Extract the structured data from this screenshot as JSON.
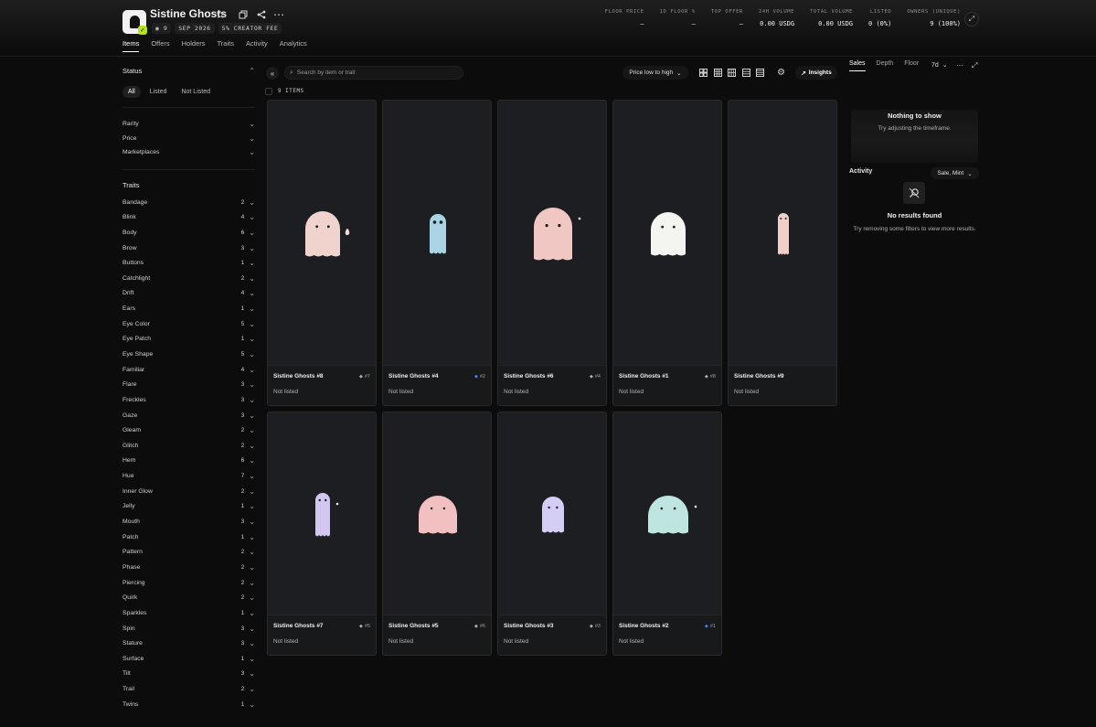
{
  "collection": {
    "title": "Sistine Ghosts",
    "items_badge": "9",
    "created": "SEP 2026",
    "creator_fee": "5% CREATOR FEE"
  },
  "header_icons": [
    "star-icon",
    "copy-icon",
    "share-icon",
    "more-icon"
  ],
  "tabs": [
    {
      "label": "Items",
      "active": true
    },
    {
      "label": "Offers",
      "active": false
    },
    {
      "label": "Holders",
      "active": false
    },
    {
      "label": "Traits",
      "active": false
    },
    {
      "label": "Activity",
      "active": false
    },
    {
      "label": "Analytics",
      "active": false
    }
  ],
  "stats": [
    {
      "label": "FLOOR PRICE",
      "value": "—"
    },
    {
      "label": "1D FLOOR %",
      "value": "—"
    },
    {
      "label": "TOP OFFER",
      "value": "—"
    },
    {
      "label": "24H VOLUME",
      "value": "0.00 USDG"
    },
    {
      "label": "TOTAL VOLUME",
      "value": "0.00 USDG"
    },
    {
      "label": "LISTED",
      "value": "0 (0%)"
    },
    {
      "label": "OWNERS (UNIQUE)",
      "value": "9 (100%)"
    }
  ],
  "sidebar": {
    "status_title": "Status",
    "status_filters": [
      {
        "label": "All",
        "active": true
      },
      {
        "label": "Listed",
        "active": false
      },
      {
        "label": "Not Listed",
        "active": false
      }
    ],
    "filters": [
      "Rarity",
      "Price",
      "Marketplaces"
    ],
    "traits_title": "Traits",
    "traits": [
      {
        "name": "Bandage",
        "count": "2"
      },
      {
        "name": "Blink",
        "count": "4"
      },
      {
        "name": "Body",
        "count": "6"
      },
      {
        "name": "Brow",
        "count": "3"
      },
      {
        "name": "Buttons",
        "count": "1"
      },
      {
        "name": "Catchlight",
        "count": "2"
      },
      {
        "name": "Drift",
        "count": "4"
      },
      {
        "name": "Ears",
        "count": "1"
      },
      {
        "name": "Eye Color",
        "count": "5"
      },
      {
        "name": "Eye Patch",
        "count": "1"
      },
      {
        "name": "Eye Shape",
        "count": "5"
      },
      {
        "name": "Familiar",
        "count": "4"
      },
      {
        "name": "Flare",
        "count": "3"
      },
      {
        "name": "Freckles",
        "count": "3"
      },
      {
        "name": "Gaze",
        "count": "3"
      },
      {
        "name": "Gleam",
        "count": "2"
      },
      {
        "name": "Glitch",
        "count": "2"
      },
      {
        "name": "Hem",
        "count": "6"
      },
      {
        "name": "Hue",
        "count": "7"
      },
      {
        "name": "Inner Glow",
        "count": "2"
      },
      {
        "name": "Jelly",
        "count": "1"
      },
      {
        "name": "Mouth",
        "count": "3"
      },
      {
        "name": "Patch",
        "count": "1"
      },
      {
        "name": "Pattern",
        "count": "2"
      },
      {
        "name": "Phase",
        "count": "2"
      },
      {
        "name": "Piercing",
        "count": "2"
      },
      {
        "name": "Quirk",
        "count": "2"
      },
      {
        "name": "Sparkles",
        "count": "1"
      },
      {
        "name": "Spin",
        "count": "3"
      },
      {
        "name": "Stature",
        "count": "3"
      },
      {
        "name": "Surface",
        "count": "1"
      },
      {
        "name": "Tilt",
        "count": "3"
      },
      {
        "name": "Trail",
        "count": "2"
      },
      {
        "name": "Twins",
        "count": "1"
      }
    ]
  },
  "toolbar": {
    "search_placeholder": "Search by item or trait",
    "sort_label": "Price low to high",
    "insights_label": "Insights",
    "items_count": "9 ITEMS"
  },
  "items": [
    {
      "name": "Sistine Ghosts #8",
      "rank": "#7",
      "rank_color": "gray",
      "price": "Not listed",
      "ghost": "pink"
    },
    {
      "name": "Sistine Ghosts #4",
      "rank": "#2",
      "rank_color": "blue",
      "price": "Not listed",
      "ghost": "blue"
    },
    {
      "name": "Sistine Ghosts #6",
      "rank": "#4",
      "rank_color": "gray",
      "price": "Not listed",
      "ghost": "pink-large"
    },
    {
      "name": "Sistine Ghosts #1",
      "rank": "#8",
      "rank_color": "gray",
      "price": "Not listed",
      "ghost": "white"
    },
    {
      "name": "Sistine Ghosts #9",
      "rank": "",
      "rank_color": "gray",
      "price": "Not listed",
      "ghost": "pink-thin"
    },
    {
      "name": "Sistine Ghosts #7",
      "rank": "#5",
      "rank_color": "gray",
      "price": "Not listed",
      "ghost": "lavender-tall"
    },
    {
      "name": "Sistine Ghosts #5",
      "rank": "#6",
      "rank_color": "gray",
      "price": "Not listed",
      "ghost": "pink-blob"
    },
    {
      "name": "Sistine Ghosts #3",
      "rank": "#3",
      "rank_color": "gray",
      "price": "Not listed",
      "ghost": "lavender"
    },
    {
      "name": "Sistine Ghosts #2",
      "rank": "#1",
      "rank_color": "blue",
      "price": "Not listed",
      "ghost": "mint"
    }
  ],
  "right_panel": {
    "tabs": [
      {
        "label": "Sales",
        "active": true
      },
      {
        "label": "Depth",
        "active": false
      },
      {
        "label": "Floor",
        "active": false
      }
    ],
    "timeframe": "7d",
    "chart_empty_title": "Nothing to show",
    "chart_empty_sub": "Try adjusting the timeframe.",
    "activity_title": "Activity",
    "activity_filter": "Sale, Mint",
    "no_results_title": "No results found",
    "no_results_sub": "Try removing some filters to view more results."
  },
  "colors": {
    "accent_blue": "#3b82f6",
    "verified_green": "#b5e61d",
    "background": "#0c0c0c",
    "card_bg": "#1c1e21"
  }
}
